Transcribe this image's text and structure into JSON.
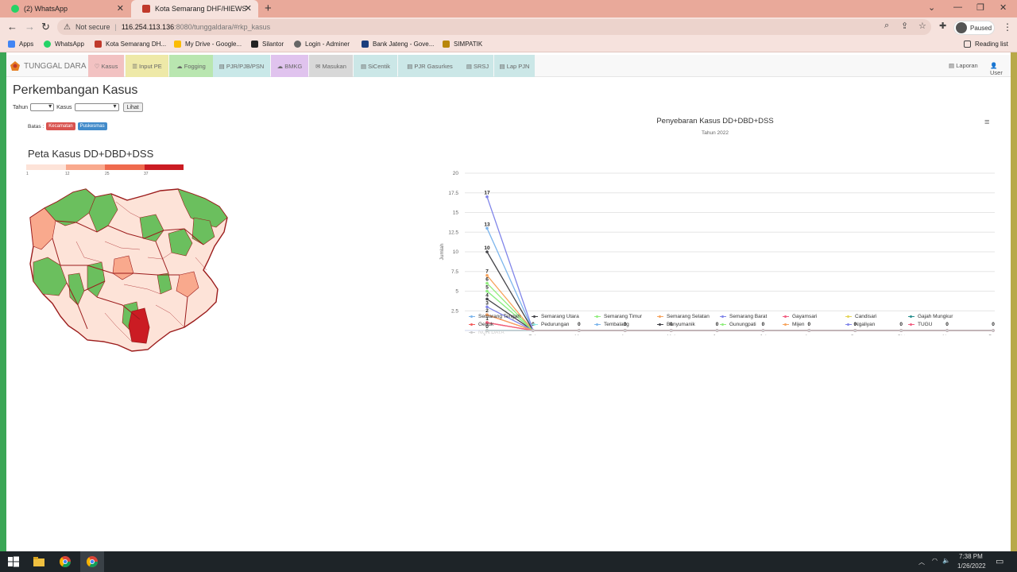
{
  "browser": {
    "tabs": [
      {
        "title": "(2) WhatsApp",
        "active": false
      },
      {
        "title": "Kota Semarang DHF/HIEWS",
        "active": true
      }
    ],
    "address": {
      "security": "Not secure",
      "host": "116.254.113.136",
      "path": ":8080/tunggaldara/#rkp_kasus"
    },
    "profile": "Paused",
    "bookmarks": [
      "Apps",
      "WhatsApp",
      "Kota Semarang DH...",
      "My Drive - Google...",
      "Silantor",
      "Login - Adminer",
      "Bank Jateng - Gove...",
      "SIMPATIK"
    ],
    "reading_list": "Reading list"
  },
  "app": {
    "brand": "TUNGGAL DARA",
    "menu": [
      {
        "label": "Kasus",
        "bg": "#f2c2c2"
      },
      {
        "label": "Input PE",
        "bg": "#eee9a8"
      },
      {
        "label": "Fogging",
        "bg": "#b9e6b0"
      },
      {
        "label": "PJR/PJB/PSN",
        "bg": "#c9e8e8"
      },
      {
        "label": "BMKG",
        "bg": "#e0c3ee"
      },
      {
        "label": "Masukan",
        "bg": "#d8d8d8"
      },
      {
        "label": "SiCentik",
        "bg": "#cbe7e7"
      },
      {
        "label": "PJR Gasurkes",
        "bg": "#cbe7e7"
      },
      {
        "label": "SRSJ",
        "bg": "#cbe7e7"
      },
      {
        "label": "Lap PJN",
        "bg": "#cbe7e7"
      }
    ],
    "menu_right": [
      "Laporan",
      "User"
    ]
  },
  "content": {
    "title": "Perkembangan Kasus",
    "filter_tahun": "Tahun",
    "filter_kasus": "Kasus",
    "lihat_button": "Lihat",
    "batas_label": "Batas :",
    "batas_kecamatan": "Kecamatan",
    "batas_puskesmas": "Puskesmas",
    "map_title": "Peta Kasus DD+DBD+DSS",
    "map_legend_ticks": [
      "1",
      "12",
      "25",
      "37"
    ],
    "map_legend_colors": [
      "#fde3d8",
      "#f9a98d",
      "#ef6a4e",
      "#cb1c23"
    ]
  },
  "chart_data": {
    "type": "line",
    "title": "Penyebaran Kasus DD+DBD+DSS",
    "subtitle": "Tahun 2022",
    "ylabel": "Jumlah",
    "ylim": [
      0,
      20
    ],
    "yticks": [
      "20",
      "17.5",
      "15",
      "12.5",
      "10",
      "7.5",
      "5",
      "2.5"
    ],
    "categories": [
      "Jan",
      "Feb",
      "Mar",
      "Apr",
      "Mei",
      "Jun",
      "Jul",
      "Agu",
      "Sep",
      "Okt",
      "Nov",
      "Des"
    ],
    "series": [
      {
        "name": "Semarang Tengah",
        "color": "#7cb5ec",
        "values": [
          0,
          0,
          0,
          0,
          0,
          0,
          0,
          0,
          0,
          0,
          0,
          0
        ]
      },
      {
        "name": "Semarang Utara",
        "color": "#434348",
        "values": [
          4,
          0,
          0,
          0,
          0,
          0,
          0,
          0,
          0,
          0,
          0,
          0
        ]
      },
      {
        "name": "Semarang Timur",
        "color": "#90ed7d",
        "values": [
          6,
          0,
          0,
          0,
          0,
          0,
          0,
          0,
          0,
          0,
          0,
          0
        ]
      },
      {
        "name": "Semarang Selatan",
        "color": "#f7a35c",
        "values": [
          7,
          0,
          0,
          0,
          0,
          0,
          0,
          0,
          0,
          0,
          0,
          0
        ]
      },
      {
        "name": "Semarang Barat",
        "color": "#8085e9",
        "values": [
          3,
          0,
          0,
          0,
          0,
          0,
          0,
          0,
          0,
          0,
          0,
          0
        ]
      },
      {
        "name": "Gayamsari",
        "color": "#f15c80",
        "values": [
          2,
          0,
          0,
          0,
          0,
          0,
          0,
          0,
          0,
          0,
          0,
          0
        ]
      },
      {
        "name": "Candisari",
        "color": "#e4d354",
        "values": [
          1,
          0,
          0,
          0,
          0,
          0,
          0,
          0,
          0,
          0,
          0,
          0
        ]
      },
      {
        "name": "Gajah Mungkur",
        "color": "#2b908f",
        "values": [
          0,
          0,
          0,
          0,
          0,
          0,
          0,
          0,
          0,
          0,
          0,
          0
        ]
      },
      {
        "name": "Genuk",
        "color": "#f45b5b",
        "values": [
          1,
          0,
          0,
          0,
          0,
          0,
          0,
          0,
          0,
          0,
          0,
          0
        ]
      },
      {
        "name": "Pedurungan",
        "color": "#91e8e1",
        "values": [
          5,
          0,
          0,
          0,
          0,
          0,
          0,
          0,
          0,
          0,
          0,
          0
        ]
      },
      {
        "name": "Tembalang",
        "color": "#7cb5ec",
        "values": [
          13,
          0,
          0,
          0,
          0,
          0,
          0,
          0,
          0,
          0,
          0,
          0
        ]
      },
      {
        "name": "Banyumanik",
        "color": "#434348",
        "values": [
          10,
          0,
          0,
          0,
          0,
          0,
          0,
          0,
          0,
          0,
          0,
          0
        ]
      },
      {
        "name": "Gunungpati",
        "color": "#90ed7d",
        "values": [
          5,
          0,
          0,
          0,
          0,
          0,
          0,
          0,
          0,
          0,
          0,
          0
        ]
      },
      {
        "name": "Mijen",
        "color": "#f7a35c",
        "values": [
          2,
          0,
          0,
          0,
          0,
          0,
          0,
          0,
          0,
          0,
          0,
          0
        ]
      },
      {
        "name": "Ngaliyan",
        "color": "#8085e9",
        "values": [
          17,
          0,
          0,
          0,
          0,
          0,
          0,
          0,
          0,
          0,
          0,
          0
        ]
      },
      {
        "name": "TUGU",
        "color": "#f15c80",
        "values": [
          1,
          0,
          0,
          0,
          0,
          0,
          0,
          0,
          0,
          0,
          0,
          0
        ]
      },
      {
        "name": "NON DATA",
        "color": "#cccccc",
        "values": [
          0,
          0,
          0,
          0,
          0,
          0,
          0,
          0,
          0,
          0,
          0,
          0
        ]
      }
    ],
    "grid": true,
    "legend_position": "bottom"
  },
  "taskbar": {
    "time": "7:38 PM",
    "date": "1/26/2022"
  }
}
